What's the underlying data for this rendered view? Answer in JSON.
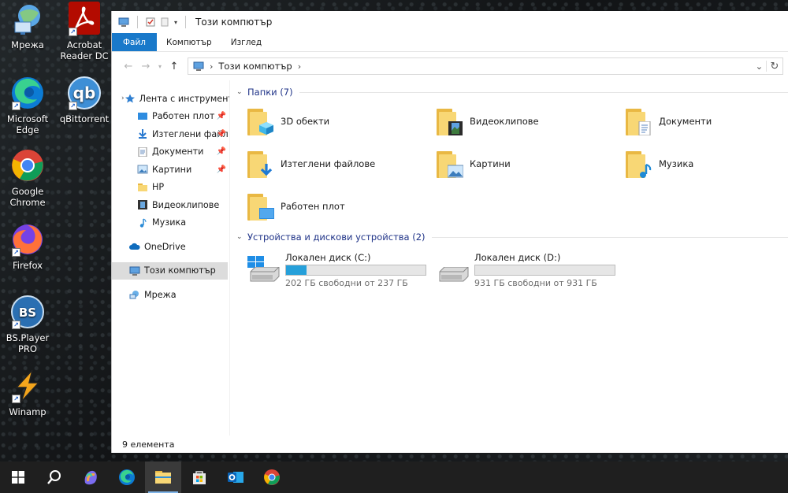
{
  "desktop": {
    "icons": [
      {
        "label": "Мрежа"
      },
      {
        "label": "Acrobat Reader DC"
      },
      {
        "label": "Microsoft Edge"
      },
      {
        "label": "qBittorrent"
      },
      {
        "label": "Google Chrome"
      },
      {
        "label": "Firefox"
      },
      {
        "label": "BS.Player PRO"
      },
      {
        "label": "Winamp"
      }
    ]
  },
  "window": {
    "title": "Този компютър",
    "ribbon_tabs": [
      "Файл",
      "Компютър",
      "Изглед"
    ],
    "address": {
      "location": "Този компютър"
    },
    "nav": {
      "quick_access": "Лента с инструменти",
      "pinned": [
        "Работен плот",
        "Изтеглени файл",
        "Документи",
        "Картини"
      ],
      "recent": [
        "HP",
        "Видеоклипове",
        "Музика"
      ],
      "onedrive": "OneDrive",
      "this_pc": "Този компютър",
      "network": "Мрежа"
    },
    "folders_header": "Папки (7)",
    "folders": [
      {
        "name": "3D обекти",
        "badge": "cube"
      },
      {
        "name": "Видеоклипове",
        "badge": "film"
      },
      {
        "name": "Документи",
        "badge": "doc"
      },
      {
        "name": "Изтеглени файлове",
        "badge": "download"
      },
      {
        "name": "Картини",
        "badge": "picture"
      },
      {
        "name": "Музика",
        "badge": "music"
      },
      {
        "name": "Работен плот",
        "badge": "desktop"
      }
    ],
    "devices_header": "Устройства и дискови устройства (2)",
    "drives": [
      {
        "name": "Локален диск (C:)",
        "free": "202 ГБ свободни от 237 ГБ",
        "used_fraction": 0.148
      },
      {
        "name": "Локален диск (D:)",
        "free": "931 ГБ свободни от 931 ГБ",
        "used_fraction": 0.0
      }
    ],
    "status": "9 елемента"
  },
  "taskbar": {
    "items": [
      "start",
      "search",
      "copilot",
      "edge",
      "file-explorer",
      "store",
      "outlook",
      "chrome"
    ]
  },
  "colors": {
    "accent": "#1979ca",
    "drive_fill": "#26a0da",
    "group_header": "#1e3287"
  }
}
